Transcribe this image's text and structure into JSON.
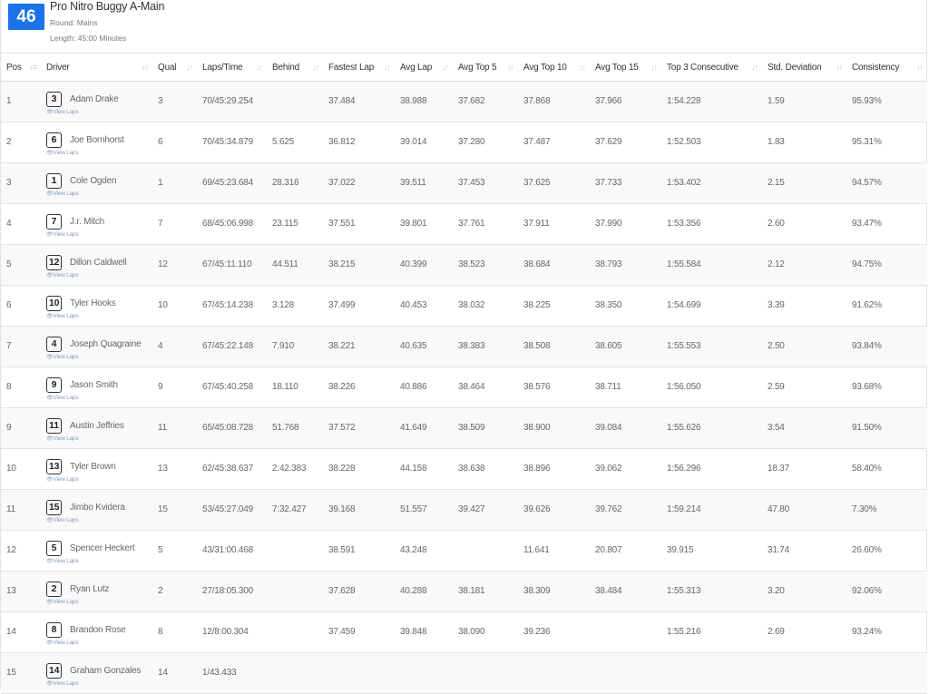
{
  "event": {
    "number": "46",
    "title": "Pro Nitro Buggy A-Main",
    "round": "Round: Mains",
    "length": "Length: 45:00 Minutes"
  },
  "view_laps_label": "View Laps",
  "columns": [
    "Pos",
    "Driver",
    "Qual",
    "Laps/Time",
    "Behind",
    "Fastest Lap",
    "Avg Lap",
    "Avg Top 5",
    "Avg Top 10",
    "Avg Top 15",
    "Top 3 Consecutive",
    "Std. Deviation",
    "Consistency"
  ],
  "rows": [
    {
      "pos": "1",
      "car": "3",
      "name": "Adam Drake",
      "qual": "3",
      "laps": "70/45:29.254",
      "behind": "",
      "fastest": "37.484",
      "avg": "38.988",
      "top5": "37.682",
      "top10": "37.868",
      "top15": "37.966",
      "top3": "1:54.228",
      "std": "1.59",
      "cons": "95.93%"
    },
    {
      "pos": "2",
      "car": "6",
      "name": "Joe Bornhorst",
      "qual": "6",
      "laps": "70/45:34.879",
      "behind": "5.625",
      "fastest": "36.812",
      "avg": "39.014",
      "top5": "37.280",
      "top10": "37.487",
      "top15": "37.629",
      "top3": "1:52.503",
      "std": "1.83",
      "cons": "95.31%"
    },
    {
      "pos": "3",
      "car": "1",
      "name": "Cole Ogden",
      "qual": "1",
      "laps": "69/45:23.684",
      "behind": "28.316",
      "fastest": "37.022",
      "avg": "39.511",
      "top5": "37.453",
      "top10": "37.625",
      "top15": "37.733",
      "top3": "1:53.402",
      "std": "2.15",
      "cons": "94.57%"
    },
    {
      "pos": "4",
      "car": "7",
      "name": "J.r. Mitch",
      "qual": "7",
      "laps": "68/45:06.998",
      "behind": "23.115",
      "fastest": "37.551",
      "avg": "39.801",
      "top5": "37.761",
      "top10": "37.911",
      "top15": "37.990",
      "top3": "1:53.356",
      "std": "2.60",
      "cons": "93.47%"
    },
    {
      "pos": "5",
      "car": "12",
      "name": "Dillon Caldwell",
      "qual": "12",
      "laps": "67/45:11.110",
      "behind": "44.511",
      "fastest": "38.215",
      "avg": "40.399",
      "top5": "38.523",
      "top10": "38.684",
      "top15": "38.793",
      "top3": "1:55.584",
      "std": "2.12",
      "cons": "94.75%"
    },
    {
      "pos": "6",
      "car": "10",
      "name": "Tyler Hooks",
      "qual": "10",
      "laps": "67/45:14.238",
      "behind": "3.128",
      "fastest": "37.499",
      "avg": "40.453",
      "top5": "38.032",
      "top10": "38.225",
      "top15": "38.350",
      "top3": "1:54.699",
      "std": "3.39",
      "cons": "91.62%"
    },
    {
      "pos": "7",
      "car": "4",
      "name": "Joseph Quagraine",
      "qual": "4",
      "laps": "67/45:22.148",
      "behind": "7.910",
      "fastest": "38.221",
      "avg": "40.635",
      "top5": "38.383",
      "top10": "38.508",
      "top15": "38.605",
      "top3": "1:55.553",
      "std": "2.50",
      "cons": "93.84%"
    },
    {
      "pos": "8",
      "car": "9",
      "name": "Jason Smith",
      "qual": "9",
      "laps": "67/45:40.258",
      "behind": "18.110",
      "fastest": "38.226",
      "avg": "40.886",
      "top5": "38.464",
      "top10": "38.576",
      "top15": "38.711",
      "top3": "1:56.050",
      "std": "2.59",
      "cons": "93.68%"
    },
    {
      "pos": "9",
      "car": "11",
      "name": "Austin Jeffries",
      "qual": "11",
      "laps": "65/45:08.728",
      "behind": "51.768",
      "fastest": "37.572",
      "avg": "41.649",
      "top5": "38.509",
      "top10": "38.900",
      "top15": "39.084",
      "top3": "1:55.626",
      "std": "3.54",
      "cons": "91.50%"
    },
    {
      "pos": "10",
      "car": "13",
      "name": "Tyler Brown",
      "qual": "13",
      "laps": "62/45:38.637",
      "behind": "2:42.383",
      "fastest": "38.228",
      "avg": "44.158",
      "top5": "38.638",
      "top10": "38.896",
      "top15": "39.062",
      "top3": "1:56.296",
      "std": "18.37",
      "cons": "58.40%"
    },
    {
      "pos": "11",
      "car": "15",
      "name": "Jimbo Kvidera",
      "qual": "15",
      "laps": "53/45:27.049",
      "behind": "7:32.427",
      "fastest": "39.168",
      "avg": "51.557",
      "top5": "39.427",
      "top10": "39.626",
      "top15": "39.762",
      "top3": "1:59.214",
      "std": "47.80",
      "cons": "7.30%"
    },
    {
      "pos": "12",
      "car": "5",
      "name": "Spencer Heckert",
      "qual": "5",
      "laps": "43/31:00.468",
      "behind": "",
      "fastest": "38.591",
      "avg": "43.248",
      "top5": "",
      "top10": "11.641",
      "top15": "20.807",
      "top3": "39.915",
      "std": "31.74",
      "cons": "26.60%"
    },
    {
      "pos": "13",
      "car": "2",
      "name": "Ryan Lutz",
      "qual": "2",
      "laps": "27/18:05.300",
      "behind": "",
      "fastest": "37.628",
      "avg": "40.288",
      "top5": "38.181",
      "top10": "38.309",
      "top15": "38.484",
      "top3": "1:55.313",
      "std": "3.20",
      "cons": "92.06%"
    },
    {
      "pos": "14",
      "car": "8",
      "name": "Brandon Rose",
      "qual": "8",
      "laps": "12/8:00.304",
      "behind": "",
      "fastest": "37.459",
      "avg": "39.848",
      "top5": "38.090",
      "top10": "39.236",
      "top15": "",
      "top3": "1:55.216",
      "std": "2.69",
      "cons": "93.24%"
    },
    {
      "pos": "15",
      "car": "14",
      "name": "Graham Gonzales",
      "qual": "14",
      "laps": "1/43.433",
      "behind": "",
      "fastest": "",
      "avg": "",
      "top5": "",
      "top10": "",
      "top15": "",
      "top3": "",
      "std": "",
      "cons": ""
    }
  ]
}
